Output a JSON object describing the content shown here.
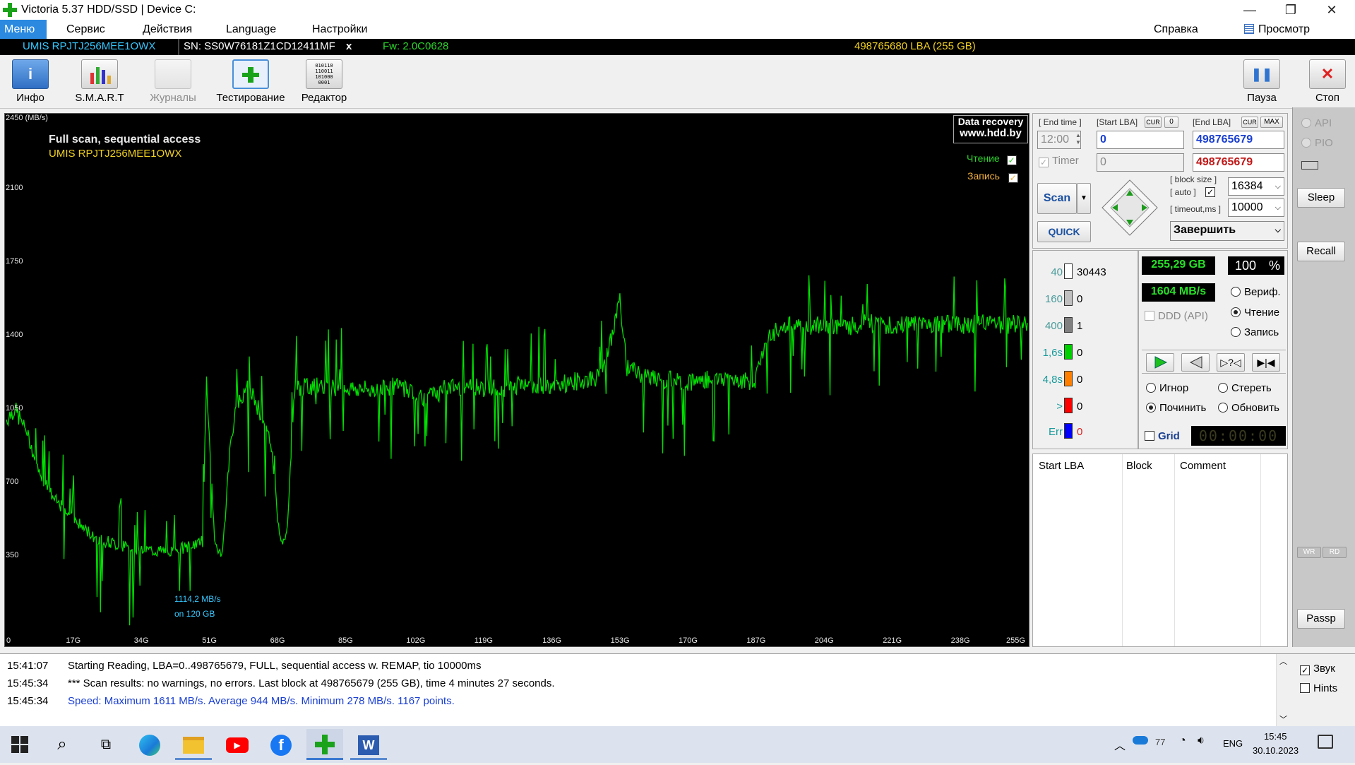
{
  "window": {
    "title": "Victoria 5.37 HDD/SSD | Device C:",
    "minimize": "—",
    "maximize": "❐",
    "close": "✕"
  },
  "menu": {
    "items": [
      "Меню",
      "Сервис",
      "Действия",
      "Language",
      "Настройки"
    ],
    "help": "Справка",
    "clipboard": "Просмотр буфера"
  },
  "device": {
    "model": "UMIS RPJTJ256MEE1OWX",
    "sn": "SN: SS0W76181Z1CD12411MF",
    "x": "x",
    "fw": "Fw: 2.0C0628",
    "lba": "498765680 LBA (255 GB)"
  },
  "toolbar": {
    "info": "Инфо",
    "smart": "S.M.A.R.T",
    "journals": "Журналы",
    "testing": "Тестирование",
    "editor": "Редактор",
    "pause": "Пауза",
    "stop": "Стоп"
  },
  "graph": {
    "unit": "2450 (MB/s)",
    "title": "Full scan, sequential access",
    "model": "UMIS RPJTJ256MEE1OWX",
    "watermark1": "Data recovery",
    "watermark2": "www.hdd.by",
    "read_label": "Чтение",
    "write_label": "Запись",
    "yticks": [
      "2100",
      "1750",
      "1400",
      "1050",
      "700",
      "350"
    ],
    "xticks": [
      "0",
      "17G",
      "34G",
      "51G",
      "68G",
      "85G",
      "102G",
      "119G",
      "136G",
      "153G",
      "170G",
      "187G",
      "204G",
      "221G",
      "238G",
      "255G"
    ],
    "annotation1": "1114,2 MB/s",
    "annotation2": "on 120 GB",
    "color_read": "#00e000"
  },
  "chart_data": {
    "type": "line",
    "title": "Full scan, sequential access",
    "ylabel": "(MB/s)",
    "xlim": [
      0,
      255
    ],
    "ylim": [
      0,
      2450
    ],
    "series": [
      {
        "name": "Чтение",
        "x": [
          0,
          2,
          5,
          8,
          12,
          17,
          22,
          28,
          34,
          40,
          45,
          49,
          50,
          52,
          54,
          56,
          58,
          60,
          62,
          64,
          66,
          67,
          68,
          69,
          70,
          72,
          74,
          76,
          80,
          85,
          90,
          95,
          100,
          105,
          110,
          115,
          119,
          125,
          130,
          136,
          142,
          148,
          150,
          152,
          153,
          155,
          160,
          170,
          180,
          185,
          187,
          190,
          195,
          200,
          204,
          210,
          215,
          221,
          225,
          230,
          238,
          245,
          250,
          255
        ],
        "y": [
          1000,
          1050,
          950,
          750,
          620,
          520,
          440,
          400,
          380,
          370,
          390,
          420,
          1200,
          400,
          370,
          900,
          1100,
          1150,
          1100,
          1000,
          900,
          700,
          500,
          400,
          450,
          1150,
          1150,
          1160,
          1150,
          1150,
          1140,
          1160,
          1150,
          1100,
          1150,
          1160,
          1150,
          1150,
          1170,
          1160,
          1180,
          1200,
          1300,
          1450,
          1600,
          1250,
          1200,
          1180,
          1200,
          1180,
          1190,
          1400,
          1450,
          1440,
          1450,
          1440,
          1460,
          1450,
          1450,
          1460,
          1450,
          1460,
          1450,
          1460
        ]
      }
    ]
  },
  "controls": {
    "end_time_lbl": "[ End time ]",
    "start_lba_lbl": "[Start LBA]",
    "cur": "CUR",
    "zero": "0",
    "end_lba_lbl": "[End LBA]",
    "max": "MAX",
    "end_time": "12:00",
    "start_lba": "0",
    "end_lba": "498765679",
    "timer": "Timer",
    "timer_val": "0",
    "end_lba2": "498765679",
    "block_size_lbl": "[ block size ]",
    "auto_lbl": "[ auto ]",
    "timeout_lbl": "[ timeout,ms ]",
    "block_size": "16384",
    "timeout": "10000",
    "scan": "Scan",
    "quick": "QUICK",
    "finish": "Завершить"
  },
  "stats": {
    "rows": [
      {
        "t": "40",
        "c": "#4a9a9a",
        "bar": "#ffffff",
        "n": "30443"
      },
      {
        "t": "160",
        "c": "#4a9a9a",
        "bar": "#c0c0c0",
        "n": "0"
      },
      {
        "t": "400",
        "c": "#4a9a9a",
        "bar": "#808080",
        "n": "1"
      },
      {
        "t": "1,6s",
        "c": "#1a9a9a",
        "bar": "#00d000",
        "n": "0"
      },
      {
        "t": "4,8s",
        "c": "#1a9a9a",
        "bar": "#ff8000",
        "n": "0"
      },
      {
        "t": ">",
        "c": "#1a9a9a",
        "bar": "#ff0000",
        "n": "0"
      },
      {
        "t": "Err",
        "c": "#1a9a9a",
        "bar": "#0000ff",
        "n": "0"
      }
    ],
    "gb": "255,29 GB",
    "percent": "100",
    "pct_sign": "%",
    "speed": "1604 MB/s",
    "ddd": "DDD (API)",
    "verify": "Вериф.",
    "read": "Чтение",
    "write": "Запись",
    "ignore": "Игнор",
    "erase": "Стереть",
    "repair": "Починить",
    "refresh": "Обновить",
    "grid": "Grid",
    "clock": "00:00:00"
  },
  "table": {
    "headers": [
      "Start LBA",
      "Block",
      "Comment"
    ]
  },
  "side": {
    "api": "API",
    "pio": "PIO",
    "sleep": "Sleep",
    "recall": "Recall",
    "wr": "WR",
    "rd": "RD",
    "passp": "Passp",
    "sound": "Звук",
    "hints": "Hints"
  },
  "log": [
    {
      "time": "15:41:07",
      "text": "Starting Reading, LBA=0..498765679, FULL, sequential access w. REMAP, tio 10000ms",
      "color": "#000000"
    },
    {
      "time": "15:45:34",
      "text": "*** Scan results: no warnings, no errors. Last block at 498765679 (255 GB), time 4 minutes 27 seconds.",
      "color": "#000000"
    },
    {
      "time": "15:45:34",
      "text": "Speed: Maximum 1611 MB/s. Average 944 MB/s. Minimum 278 MB/s. 1167 points.",
      "color": "#1a3fd0"
    }
  ],
  "taskbar": {
    "temp": "77",
    "lang": "ENG",
    "time": "15:45",
    "date": "30.10.2023"
  }
}
